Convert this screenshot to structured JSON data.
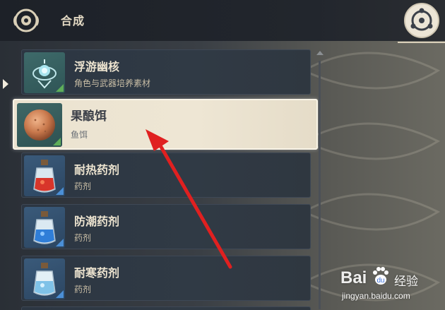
{
  "header": {
    "title": "合成",
    "left_icon": "crafting-emblem-icon",
    "right_icon": "settings-emblem-icon"
  },
  "items": [
    {
      "name": "浮游幽核",
      "category": "角色与武器培养素材",
      "icon": "floating-core-icon",
      "rarity": "green"
    },
    {
      "name": "果酿饵",
      "category": "鱼饵",
      "icon": "fruit-bait-icon",
      "rarity": "green",
      "selected": true
    },
    {
      "name": "耐热药剂",
      "category": "药剂",
      "icon": "heatshield-potion-icon",
      "rarity": "blue"
    },
    {
      "name": "防潮药剂",
      "category": "药剂",
      "icon": "dustproof-potion-icon",
      "rarity": "blue"
    },
    {
      "name": "耐寒药剂",
      "category": "药剂",
      "icon": "frostshield-potion-icon",
      "rarity": "blue"
    }
  ],
  "watermark": {
    "brand": "Bai",
    "brand_cn": "经验",
    "url": "jingyan.baidu.com"
  },
  "colors": {
    "selected_bg": "#ebe3d0",
    "item_bg": "#2c3642",
    "rarity_green": "#5fae5a",
    "rarity_blue": "#4b8fd6",
    "annotation_arrow": "#e02020"
  }
}
